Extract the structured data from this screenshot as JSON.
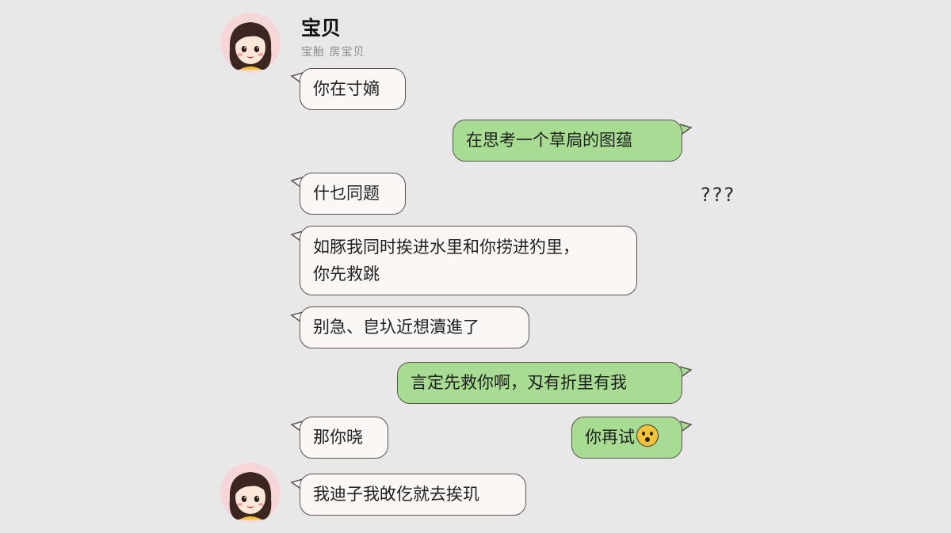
{
  "contact": {
    "name": "宝贝",
    "subtitle": "宝胎 房宝贝"
  },
  "messages": [
    {
      "side": "in",
      "text": "你在寸嫡"
    },
    {
      "side": "out",
      "text": "在思考一个草扃的图蕴"
    },
    {
      "side": "in",
      "text": "什乜同题"
    },
    {
      "side": "in",
      "lines": [
        "如豚我同时挨进水里和你捞进犳里，",
        "你先救跳"
      ]
    },
    {
      "side": "in",
      "text": "别急、皀圦近想瀆進了"
    },
    {
      "side": "out",
      "text": "言定先救你啊，刄有折里有我"
    },
    {
      "side": "in",
      "text": "那你晓"
    },
    {
      "side": "out",
      "text": "你再试",
      "emoji": "hushed-face"
    },
    {
      "side": "in",
      "text": "我迪子我敀仡就去挨玑"
    }
  ],
  "aside_text": "???",
  "colors": {
    "background": "#e9e8e9",
    "incoming_bubble": "#fbf7f5",
    "outgoing_bubble": "#a7dc92",
    "bubble_border": "#5b5353"
  }
}
